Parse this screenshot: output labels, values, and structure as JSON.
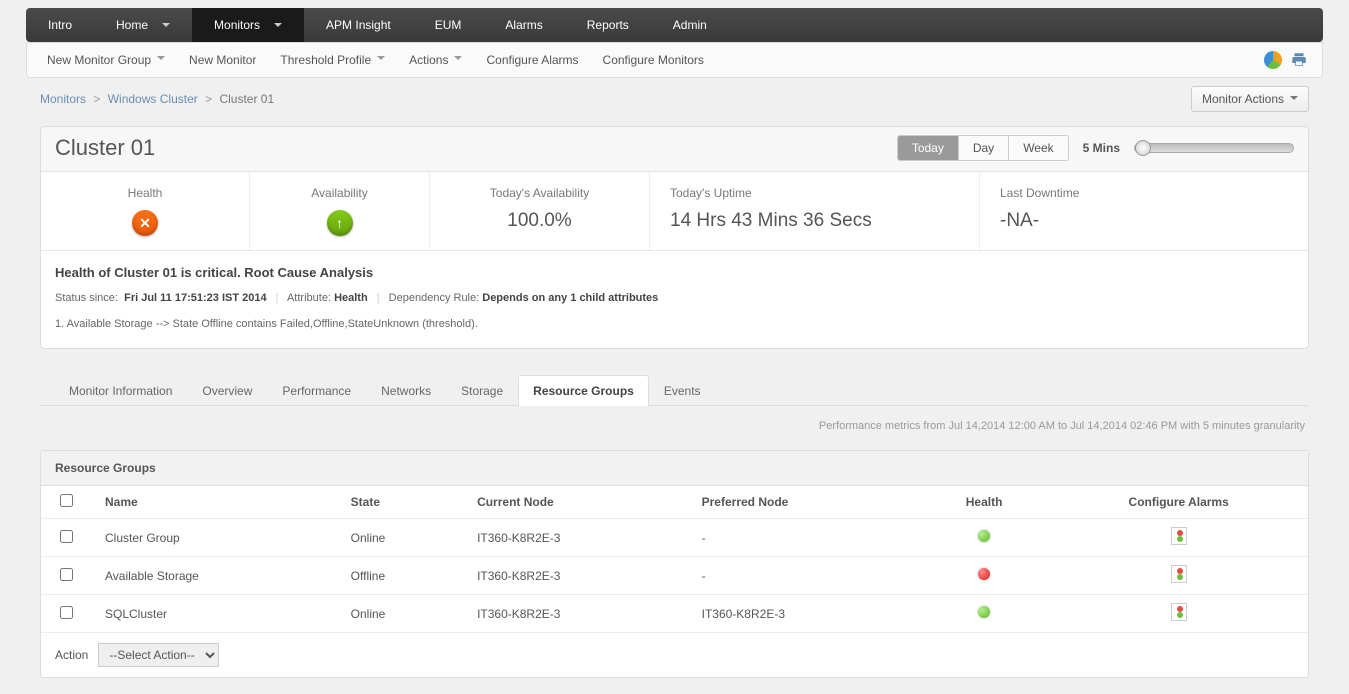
{
  "topnav": [
    "Intro",
    "Home",
    "Monitors",
    "APM Insight",
    "EUM",
    "Alarms",
    "Reports",
    "Admin"
  ],
  "topnav_active": 2,
  "topnav_dd": [
    1,
    2
  ],
  "subnav": [
    {
      "label": "New Monitor Group",
      "dd": true
    },
    {
      "label": "New Monitor",
      "dd": false
    },
    {
      "label": "Threshold Profile",
      "dd": true
    },
    {
      "label": "Actions",
      "dd": true
    },
    {
      "label": "Configure Alarms",
      "dd": false
    },
    {
      "label": "Configure Monitors",
      "dd": false
    }
  ],
  "breadcrumb": {
    "l1": "Monitors",
    "l2": "Windows Cluster",
    "current": "Cluster 01"
  },
  "monitor_actions_label": "Monitor Actions",
  "title": "Cluster 01",
  "time_segments": [
    "Today",
    "Day",
    "Week"
  ],
  "time_active": 0,
  "refresh_label": "5 Mins",
  "stats": {
    "health_label": "Health",
    "availability_label": "Availability",
    "todays_availability": {
      "label": "Today's Availability",
      "value": "100.0%"
    },
    "uptime": {
      "label": "Today's Uptime",
      "value": "14 Hrs 43 Mins 36 Secs"
    },
    "last_downtime": {
      "label": "Last Downtime",
      "value": "-NA-"
    }
  },
  "rca": {
    "title": "Health of Cluster 01 is critical. Root Cause Analysis",
    "status_since_label": "Status since:",
    "status_since": "Fri Jul 11 17:51:23 IST 2014",
    "attribute_label": "Attribute:",
    "attribute": "Health",
    "dep_label": "Dependency Rule:",
    "dep": "Depends on any 1 child attributes",
    "item": "1. Available Storage --> State Offline contains Failed,Offline,StateUnknown (threshold)."
  },
  "tabs": [
    "Monitor Information",
    "Overview",
    "Performance",
    "Networks",
    "Storage",
    "Resource Groups",
    "Events"
  ],
  "tab_active": 5,
  "perf_note": "Performance metrics from Jul 14,2014 12:00 AM to Jul 14,2014 02:46 PM with 5 minutes granularity",
  "table": {
    "title": "Resource Groups",
    "cols": [
      "Name",
      "State",
      "Current Node",
      "Preferred Node",
      "Health",
      "Configure Alarms"
    ],
    "rows": [
      {
        "name": "Cluster Group",
        "state": "Online",
        "current": "IT360-K8R2E-3",
        "preferred": "-",
        "health": "green"
      },
      {
        "name": "Available Storage",
        "state": "Offline",
        "current": "IT360-K8R2E-3",
        "preferred": "-",
        "health": "red"
      },
      {
        "name": "SQLCluster",
        "state": "Online",
        "current": "IT360-K8R2E-3",
        "preferred": "IT360-K8R2E-3",
        "health": "green"
      }
    ],
    "action_label": "Action",
    "action_placeholder": "--Select Action--"
  }
}
